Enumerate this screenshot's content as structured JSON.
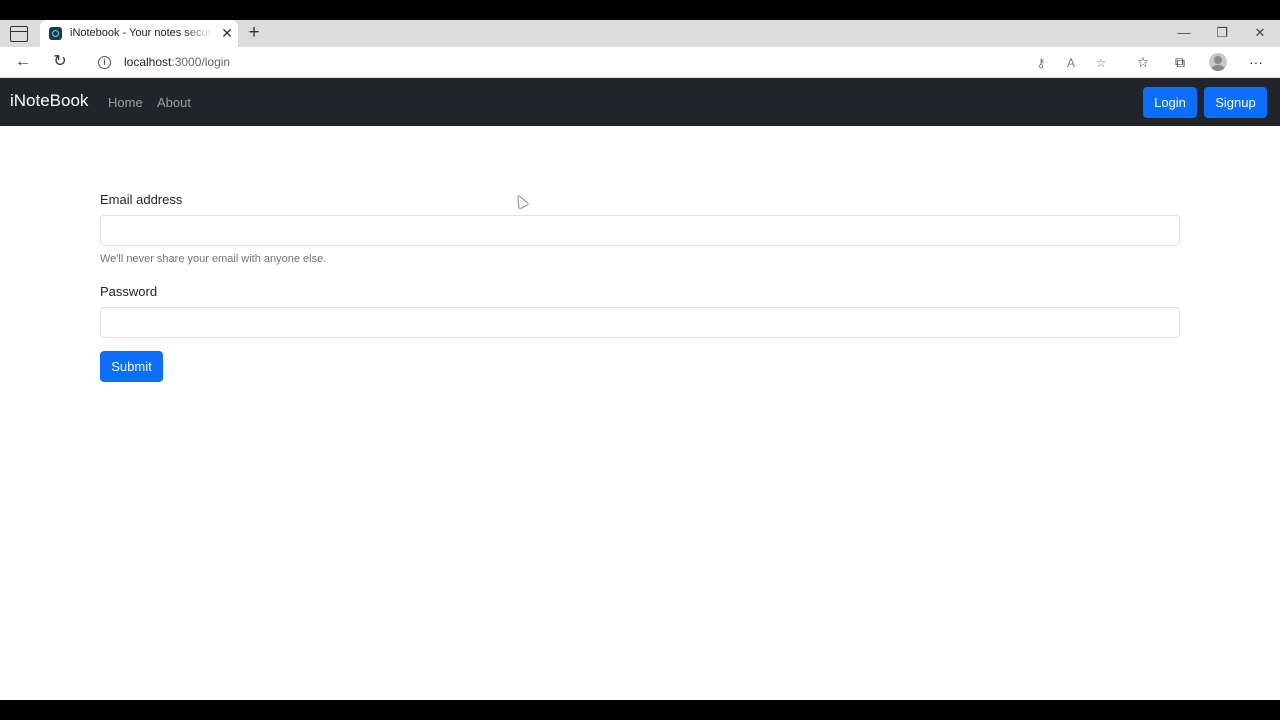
{
  "browser": {
    "tab": {
      "title": "iNotebook - Your notes secured on the cloud",
      "close_glyph": "✕"
    },
    "new_tab_glyph": "+",
    "window_controls": {
      "minimize": "—",
      "restore": "❐",
      "close": "✕"
    },
    "nav": {
      "back": "←",
      "refresh": "↻"
    },
    "address": {
      "host": "localhost",
      "path": ":3000/login",
      "info_glyph": "i"
    },
    "address_icons": {
      "key": "⚷",
      "read_aloud": "A",
      "favorite": "☆"
    },
    "toolbar_icons": {
      "favorites": "☆",
      "collections": "⧉",
      "more": "···"
    }
  },
  "navbar": {
    "brand": "iNoteBook",
    "links": [
      {
        "label": "Home"
      },
      {
        "label": "About"
      }
    ],
    "login_label": "Login",
    "signup_label": "Signup"
  },
  "form": {
    "email_label": "Email address",
    "email_value": "",
    "email_help": "We'll never share your email with anyone else.",
    "password_label": "Password",
    "password_value": "",
    "submit_label": "Submit"
  },
  "colors": {
    "navbar_bg": "#212529",
    "primary": "#0d6efd",
    "tabstrip_bg": "#dcdcdc"
  }
}
